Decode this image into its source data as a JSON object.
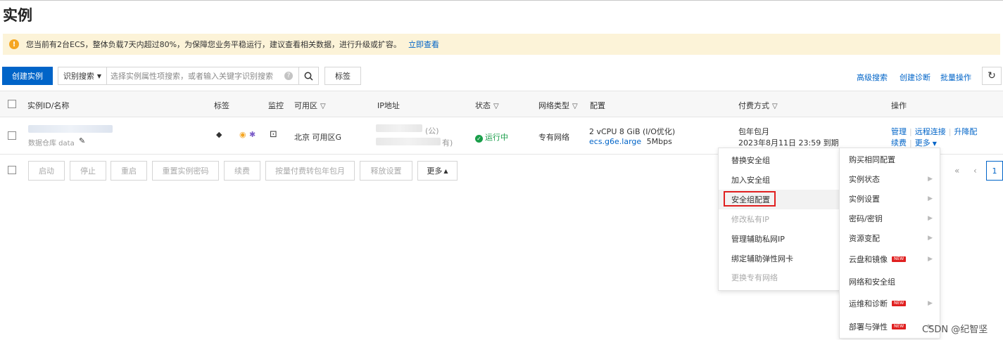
{
  "page": {
    "title": "实例"
  },
  "notice": {
    "text": "您当前有2台ECS，整体负载7天内超过80%，为保障您业务平稳运行，建议查看相关数据，进行升级或扩容。",
    "link": "立即查看"
  },
  "toolbar": {
    "create_label": "创建实例",
    "search_type": "识别搜索",
    "search_placeholder": "选择实例属性项搜索，或者输入关键字识别搜索",
    "tag_label": "标签",
    "advanced_search": "高级搜索",
    "create_diagnosis": "创建诊断",
    "batch_ops": "批量操作"
  },
  "table": {
    "columns": {
      "id_name": "实例ID/名称",
      "tag": "标签",
      "monitor": "监控",
      "zone": "可用区",
      "ip": "IP地址",
      "status": "状态",
      "network": "网络类型",
      "config": "配置",
      "billing": "付费方式",
      "actions": "操作"
    },
    "row": {
      "name_partial": "数据仓库 data",
      "zone": "北京 可用区G",
      "ip_public_suffix": "(公)",
      "ip_private_suffix": "有)",
      "status": "运行中",
      "network": "专有网络",
      "config_line1": "2 vCPU 8 GiB   (I/O优化)",
      "config_type": "ecs.g6e.large",
      "config_bw": "5Mbps",
      "billing_line1": "包年包月",
      "billing_line2": "2023年8月11日 23:59 到期",
      "actions": {
        "manage": "管理",
        "remote": "远程连接",
        "resize": "升降配",
        "renew": "续费",
        "more": "更多"
      }
    }
  },
  "bottom_actions": [
    "启动",
    "停止",
    "重启",
    "重置实例密码",
    "续费",
    "按量付费转包年包月",
    "释放设置",
    "更多"
  ],
  "pager": {
    "first": "«",
    "prev": "‹",
    "current": "1"
  },
  "submenu_left": [
    {
      "label": "替换安全组",
      "disabled": false
    },
    {
      "label": "加入安全组",
      "disabled": false
    },
    {
      "label": "安全组配置",
      "disabled": false
    },
    {
      "label": "修改私有IP",
      "disabled": true
    },
    {
      "label": "管理辅助私网IP",
      "disabled": false
    },
    {
      "label": "绑定辅助弹性网卡",
      "disabled": false
    },
    {
      "label": "更换专有网络",
      "disabled": true
    }
  ],
  "submenu_right": [
    {
      "label": "购买相同配置",
      "arrow": false,
      "badge": false
    },
    {
      "label": "实例状态",
      "arrow": true,
      "badge": false
    },
    {
      "label": "实例设置",
      "arrow": true,
      "badge": false
    },
    {
      "label": "密码/密钥",
      "arrow": true,
      "badge": false
    },
    {
      "label": "资源变配",
      "arrow": true,
      "badge": false
    },
    {
      "label": "云盘和镜像",
      "arrow": true,
      "badge": true
    },
    {
      "label": "网络和安全组",
      "arrow": false,
      "badge": false
    },
    {
      "label": "运维和诊断",
      "arrow": true,
      "badge": true
    },
    {
      "label": "部署与弹性",
      "arrow": true,
      "badge": true
    }
  ],
  "badge_text": "NEW",
  "watermark": "CSDN @纪智坚",
  "colors": {
    "accent": "#0064c8",
    "success": "#1a9e4a",
    "highlight": "#e02020",
    "notice_bg": "#fcf3d8"
  }
}
